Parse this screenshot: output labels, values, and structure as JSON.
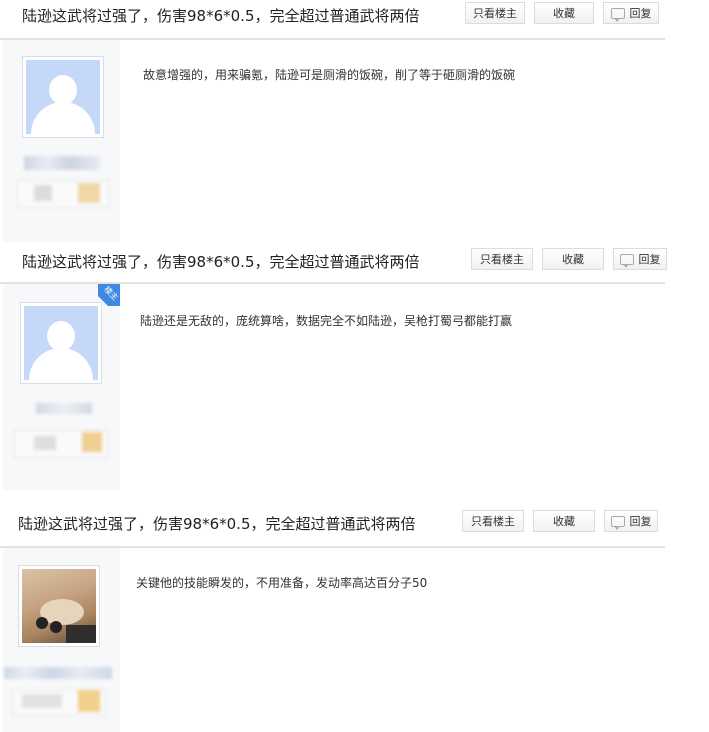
{
  "header": {
    "title": "陆逊这武将过强了，伤害98*6*0.5，完全超过普通武将两倍",
    "buttons": {
      "only_op": "只看楼主",
      "favorite": "收藏",
      "reply": "回复"
    }
  },
  "op_badge": "楼主",
  "posts": [
    {
      "text": "故意增强的，用来骗氪，陆逊可是厕滑的饭碗，削了等于砸厕滑的饭碗",
      "avatar": "default-avatar",
      "is_op": false
    },
    {
      "text": "陆逊还是无敌的，庞统算啥，数据完全不如陆逊，吴枪打蜀弓都能打赢",
      "avatar": "default-avatar",
      "is_op": true
    },
    {
      "text": "关键他的技能瞬发的，不用准备，发动率高达百分子50",
      "avatar": "photo-avatar",
      "is_op": false
    }
  ]
}
